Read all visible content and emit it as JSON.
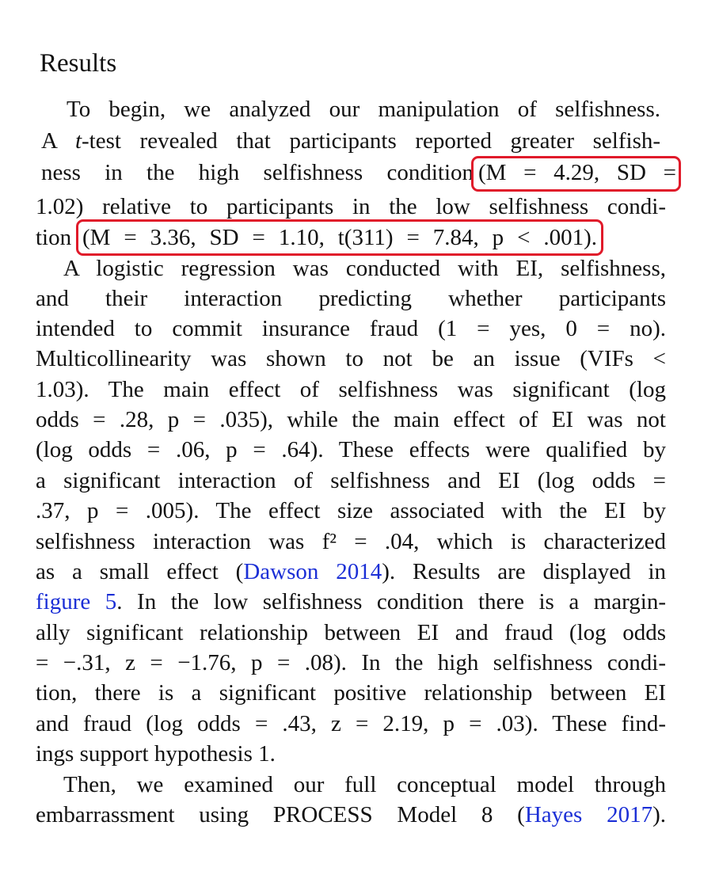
{
  "section_title": "Results",
  "p1": {
    "l1": "To begin, we analyzed our manipulation of selfishness.",
    "l2_pre": "A ",
    "l2_it": "t",
    "l2_post": "-test revealed that participants reported greater selfish-",
    "l3": "ness in the high selfishness condition",
    "l3_box": "(M = 4.29, SD =",
    "l4": "1.02) relative to participants in the low selfishness condi-",
    "l5_pre": "tion",
    "l5_box": "(M = 3.36, SD = 1.10, t(311) = 7.84, p < .001)."
  },
  "p2": {
    "l1": "A logistic regression was conducted with EI, selfishness,",
    "l2": "and their interaction predicting whether participants",
    "l3": "intended to commit insurance fraud (1 = yes, 0 = no).",
    "l4": "Multicollinearity was shown to not be an issue (VIFs <",
    "l5": "1.03). The main effect of selfishness was significant (log",
    "l6": "odds = .28, p = .035), while the main effect of EI was not",
    "l7": "(log odds = .06, p = .64). These effects were qualified by",
    "l8": "a significant interaction of selfishness and EI (log odds =",
    "l9": ".37, p = .005). The effect size associated with the EI by",
    "l10": "selfishness interaction was f² = .04, which is characterized",
    "l11_pre": "as a small effect (",
    "l11_link": "Dawson 2014",
    "l11_post": "). Results are displayed in",
    "l12_link": "figure 5",
    "l12_post": ". In the low selfishness condition there is a margin-",
    "l13": "ally significant relationship between EI and fraud (log odds",
    "l14": "= −.31, z = −1.76, p = .08). In the high selfishness condi-",
    "l15": "tion, there is a significant positive relationship between EI",
    "l16": "and fraud (log odds = .43, z = 2.19, p = .03). These find-",
    "l17": "ings support hypothesis 1."
  },
  "p3": {
    "l1": "Then, we examined our full conceptual model through",
    "l2_pre": "embarrassment using PROCESS Model 8 (",
    "l2_link": "Hayes 2017",
    "l2_post": ")."
  },
  "colors": {
    "text": "#111111",
    "link": "#1b2fd6",
    "highlight": "#e01a2a"
  }
}
